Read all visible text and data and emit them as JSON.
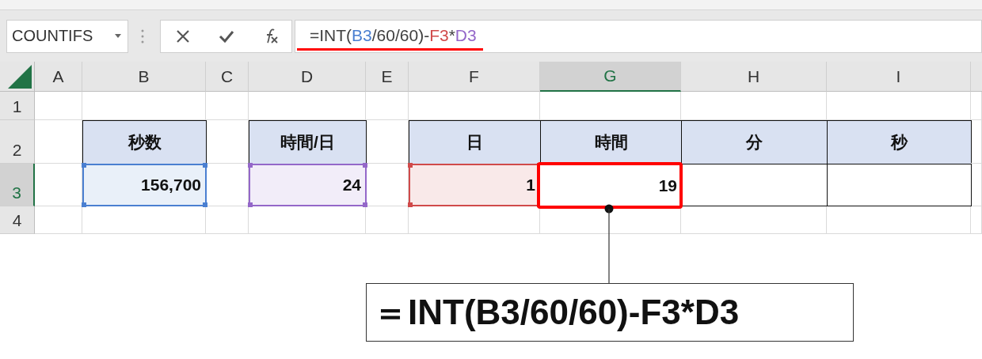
{
  "name_box": {
    "value": "COUNTIFS"
  },
  "formula_bar": {
    "tokens": [
      {
        "text": "=INT(",
        "color": "#404040"
      },
      {
        "text": "B3",
        "color": "#4a7fd1"
      },
      {
        "text": "/60/60)-",
        "color": "#404040"
      },
      {
        "text": "F3",
        "color": "#d04a4a"
      },
      {
        "text": "*",
        "color": "#404040"
      },
      {
        "text": "D3",
        "color": "#9467c9"
      }
    ]
  },
  "columns": [
    {
      "label": "A",
      "selected": false
    },
    {
      "label": "B",
      "selected": false
    },
    {
      "label": "C",
      "selected": false
    },
    {
      "label": "D",
      "selected": false
    },
    {
      "label": "E",
      "selected": false
    },
    {
      "label": "F",
      "selected": false
    },
    {
      "label": "G",
      "selected": true
    },
    {
      "label": "H",
      "selected": false
    },
    {
      "label": "I",
      "selected": false
    }
  ],
  "rows": [
    {
      "label": "1",
      "selected": false,
      "cells": [
        {
          "kind": "empty"
        },
        {
          "kind": "empty"
        },
        {
          "kind": "empty"
        },
        {
          "kind": "empty"
        },
        {
          "kind": "empty"
        },
        {
          "kind": "empty"
        },
        {
          "kind": "empty"
        },
        {
          "kind": "empty"
        },
        {
          "kind": "empty"
        }
      ]
    },
    {
      "label": "2",
      "selected": false,
      "cells": [
        {
          "kind": "empty"
        },
        {
          "kind": "header",
          "text": "秒数"
        },
        {
          "kind": "empty"
        },
        {
          "kind": "header",
          "text": "時間/日"
        },
        {
          "kind": "empty"
        },
        {
          "kind": "header",
          "text": "日"
        },
        {
          "kind": "header",
          "text": "時間"
        },
        {
          "kind": "header",
          "text": "分"
        },
        {
          "kind": "header",
          "text": "秒"
        }
      ]
    },
    {
      "label": "3",
      "selected": true,
      "cells": [
        {
          "kind": "empty"
        },
        {
          "kind": "value",
          "text": "156,700",
          "color": "#4a7fd1",
          "highlighted": false
        },
        {
          "kind": "empty"
        },
        {
          "kind": "value",
          "text": "24",
          "color": "#9467c9",
          "highlighted": false
        },
        {
          "kind": "empty"
        },
        {
          "kind": "value",
          "text": "1",
          "color": "#d04a4a",
          "highlighted": false
        },
        {
          "kind": "value",
          "text": "19",
          "highlighted": true
        },
        {
          "kind": "value",
          "highlighted": false
        },
        {
          "kind": "value",
          "highlighted": false
        }
      ]
    },
    {
      "label": "4",
      "selected": false,
      "cells": [
        {
          "kind": "empty"
        },
        {
          "kind": "empty"
        },
        {
          "kind": "empty"
        },
        {
          "kind": "empty"
        },
        {
          "kind": "empty"
        },
        {
          "kind": "empty"
        },
        {
          "kind": "empty"
        },
        {
          "kind": "empty"
        },
        {
          "kind": "empty"
        }
      ]
    }
  ],
  "callout": {
    "text": "＝INT(B3/60/60)-F3*D3"
  }
}
